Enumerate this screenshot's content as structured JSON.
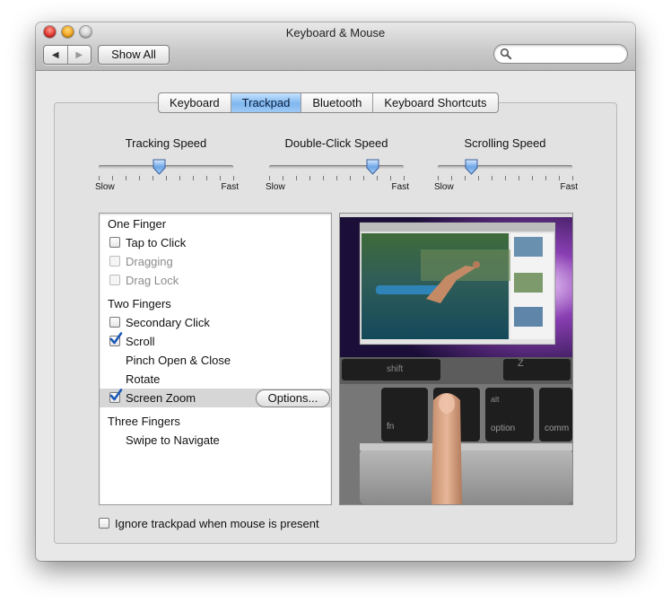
{
  "window": {
    "title": "Keyboard & Mouse"
  },
  "toolbar": {
    "back_glyph": "◀",
    "forward_glyph": "▶",
    "show_all_label": "Show All",
    "search_placeholder": ""
  },
  "tabs": [
    {
      "label": "Keyboard",
      "active": false
    },
    {
      "label": "Trackpad",
      "active": true
    },
    {
      "label": "Bluetooth",
      "active": false
    },
    {
      "label": "Keyboard Shortcuts",
      "active": false
    }
  ],
  "sliders": [
    {
      "label": "Tracking Speed",
      "min_label": "Slow",
      "max_label": "Fast",
      "value": 0.45
    },
    {
      "label": "Double-Click Speed",
      "min_label": "Slow",
      "max_label": "Fast",
      "value": 0.77
    },
    {
      "label": "Scrolling Speed",
      "min_label": "Slow",
      "max_label": "Fast",
      "value": 0.25
    }
  ],
  "gestures": {
    "one_finger_header": "One Finger",
    "tap_to_click": {
      "label": "Tap to Click",
      "checked": false,
      "enabled": true
    },
    "dragging": {
      "label": "Dragging",
      "checked": false,
      "enabled": false
    },
    "drag_lock": {
      "label": "Drag Lock",
      "checked": false,
      "enabled": false
    },
    "two_fingers_header": "Two Fingers",
    "secondary_click": {
      "label": "Secondary Click",
      "checked": false,
      "enabled": true
    },
    "scroll": {
      "label": "Scroll",
      "checked": true,
      "enabled": true
    },
    "pinch": {
      "label": "Pinch Open & Close"
    },
    "rotate": {
      "label": "Rotate"
    },
    "screen_zoom": {
      "label": "Screen Zoom",
      "checked": true,
      "enabled": true
    },
    "options_button": "Options...",
    "three_fingers_header": "Three Fingers",
    "swipe": {
      "label": "Swipe to Navigate"
    }
  },
  "preview": {
    "keys": [
      "shift",
      "fn",
      "alt",
      "option",
      "comm",
      "Z"
    ]
  },
  "bottom": {
    "ignore_trackpad_label": "Ignore trackpad when mouse is present",
    "checked": false
  },
  "colors": {
    "tab_active": "#7fb7ef",
    "check_blue": "#1b58b8",
    "window_bg": "#e8e8e8"
  }
}
